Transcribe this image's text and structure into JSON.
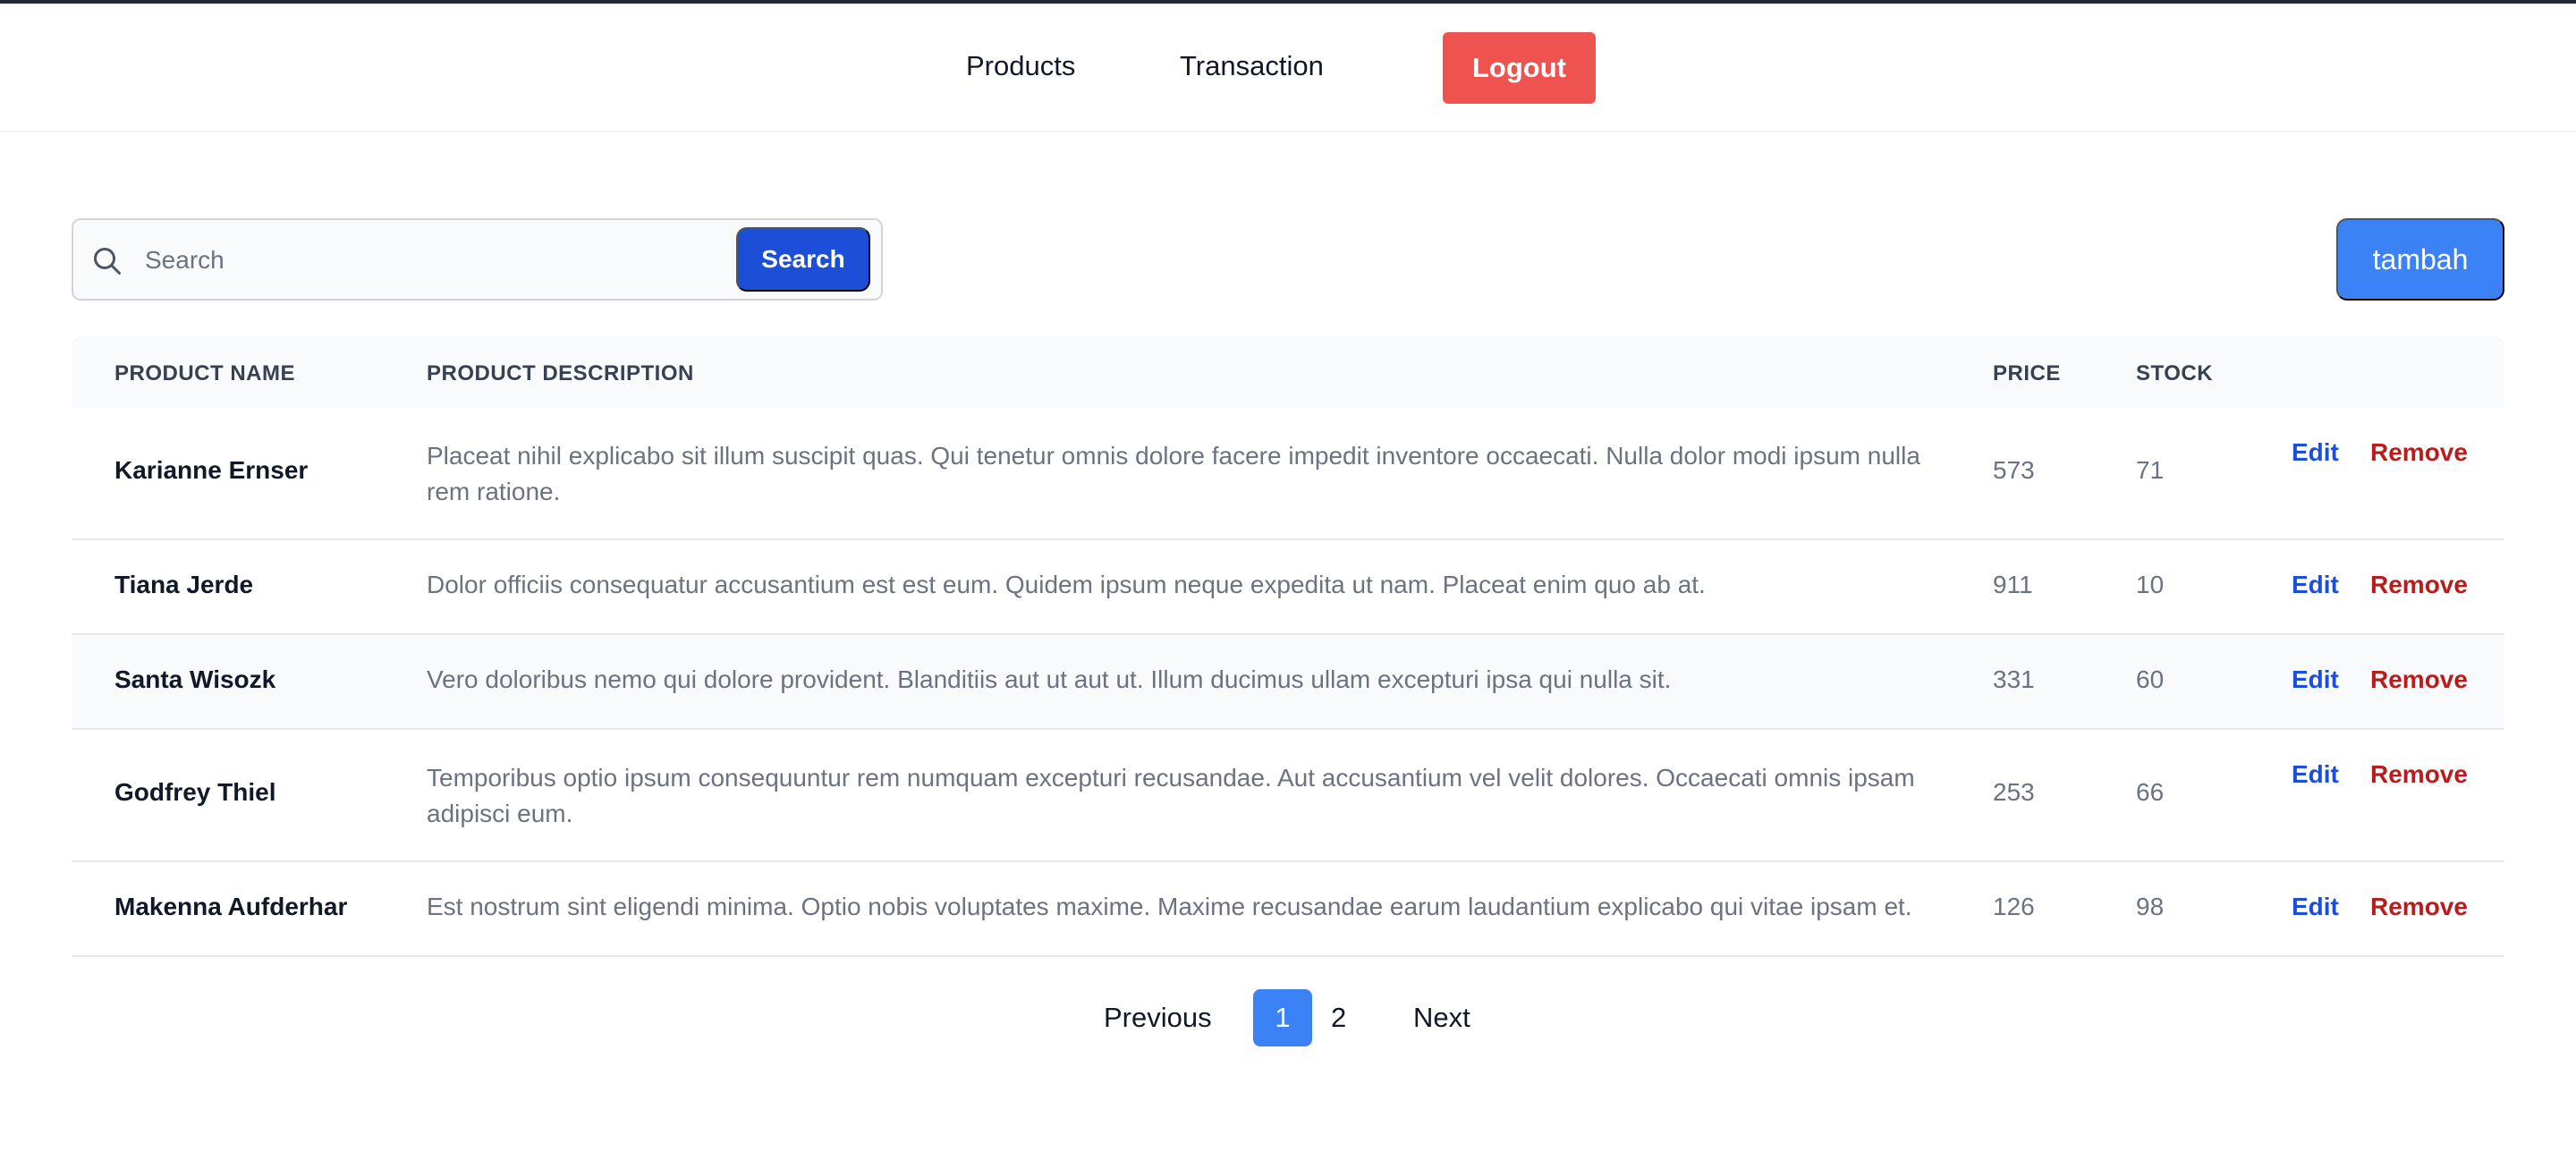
{
  "nav": {
    "products_label": "Products",
    "transaction_label": "Transaction",
    "logout_label": "Logout"
  },
  "search": {
    "placeholder": "Search",
    "value": "",
    "button_label": "Search"
  },
  "add_button_label": "tambah",
  "table": {
    "headers": [
      "PRODUCT NAME",
      "PRODUCT DESCRIPTION",
      "PRICE",
      "STOCK"
    ],
    "rows": [
      {
        "name": "Karianne Ernser",
        "description": "Placeat nihil explicabo sit illum suscipit quas. Qui tenetur omnis dolore facere impedit inventore occaecati. Nulla dolor modi ipsum nulla rem ratione.",
        "price": "573",
        "stock": "71",
        "edit": "Edit",
        "remove": "Remove"
      },
      {
        "name": "Tiana Jerde",
        "description": "Dolor officiis consequatur accusantium est est eum. Quidem ipsum neque expedita ut nam. Placeat enim quo ab at.",
        "price": "911",
        "stock": "10",
        "edit": "Edit",
        "remove": "Remove"
      },
      {
        "name": "Santa Wisozk",
        "description": "Vero doloribus nemo qui dolore provident. Blanditiis aut ut aut ut. Illum ducimus ullam excepturi ipsa qui nulla sit.",
        "price": "331",
        "stock": "60",
        "edit": "Edit",
        "remove": "Remove"
      },
      {
        "name": "Godfrey Thiel",
        "description": "Temporibus optio ipsum consequuntur rem numquam excepturi recusandae. Aut accusantium vel velit dolores. Occaecati omnis ipsam adipisci eum.",
        "price": "253",
        "stock": "66",
        "edit": "Edit",
        "remove": "Remove"
      },
      {
        "name": "Makenna Aufderhar",
        "description": "Est nostrum sint eligendi minima. Optio nobis voluptates maxime. Maxime recusandae earum laudantium explicabo qui vitae ipsam et.",
        "price": "126",
        "stock": "98",
        "edit": "Edit",
        "remove": "Remove"
      }
    ]
  },
  "pagination": {
    "previous_label": "Previous",
    "pages": [
      "1",
      "2"
    ],
    "current_page": "1",
    "next_label": "Next"
  },
  "colors": {
    "logout": "#ef5350",
    "primary": "#1d4ed8",
    "accent": "#3b82f6",
    "remove": "#b91c1c"
  },
  "icons": {
    "search": "search-icon"
  }
}
